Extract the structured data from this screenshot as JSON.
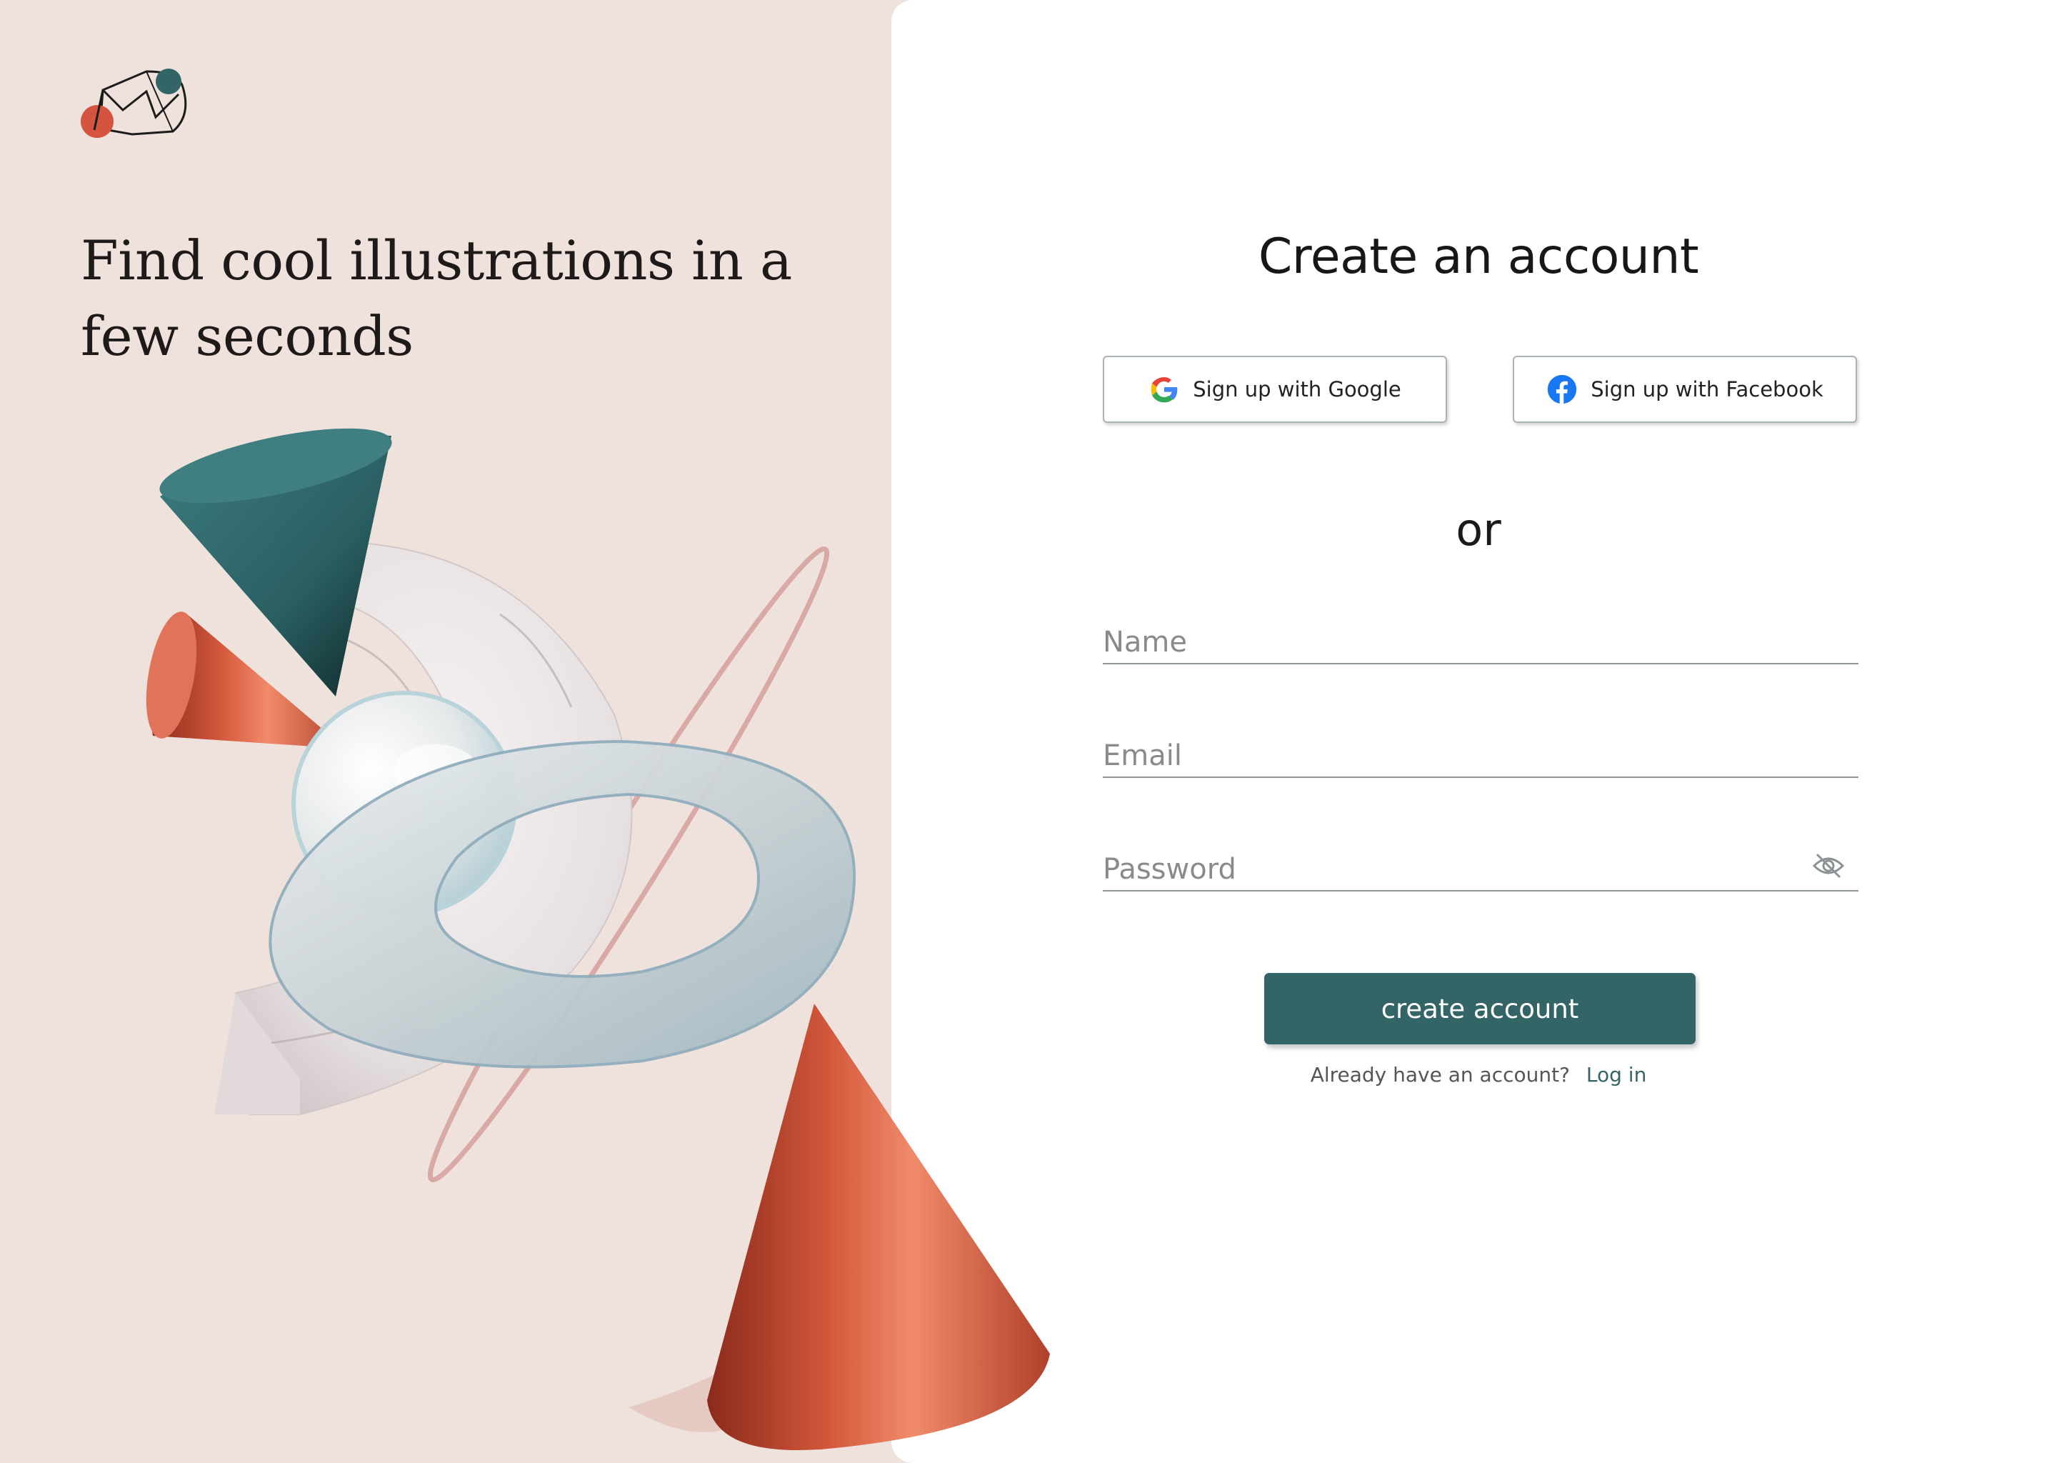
{
  "brand": {
    "logo_icon": "abstract-envelope-logo-icon",
    "colors": {
      "red": "#d5543d",
      "teal": "#336466"
    }
  },
  "hero": {
    "headline": "Find cool illustrations in a few seconds",
    "illustration": "3d-shapes-illustration"
  },
  "form": {
    "title": "Create an account",
    "google_label": "Sign up with Google",
    "facebook_label": "Sign up with Facebook",
    "divider": "or",
    "name_placeholder": "Name",
    "email_placeholder": "Email",
    "password_placeholder": "Password",
    "password_toggle_icon": "eye-off-icon",
    "submit_label": "create account",
    "already_text": "Already have an account?",
    "login_label": "Log in"
  },
  "theme": {
    "left_bg": "#efe2dc",
    "right_bg": "#ffffff",
    "accent": "#336466"
  }
}
